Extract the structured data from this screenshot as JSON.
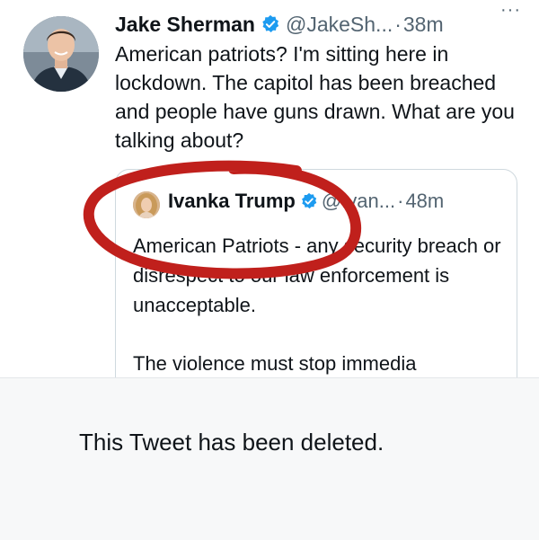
{
  "tweet": {
    "author_name": "Jake Sherman",
    "handle": "@JakeSh...",
    "separator": "·",
    "time": "38m",
    "more_label": "···",
    "text": "American patriots? I'm sitting here in lockdown. The capitol has been breached and people have guns drawn. What are you talking about?",
    "avatar_icon": "profile-photo-man",
    "verified_icon": "verified-badge-icon"
  },
  "quoted_tweet": {
    "author_name": "Ivanka Trump",
    "handle": "@Ivan...",
    "separator": "·",
    "time": "48m",
    "text_p1": "American Patriots - any security breach or disrespect to our law enforcement is unacceptable.",
    "text_p2": "The violence must stop immedia",
    "avatar_icon": "profile-photo-woman",
    "verified_icon": "verified-badge-icon"
  },
  "annotation": {
    "type": "hand-drawn-circle",
    "color": "#c0201c"
  },
  "deleted_notice": {
    "text": "This Tweet has been deleted."
  },
  "colors": {
    "verified_blue": "#1d9bf0",
    "secondary_text": "#536471",
    "border": "#cfd9de",
    "notice_background": "#f7f8f9"
  }
}
